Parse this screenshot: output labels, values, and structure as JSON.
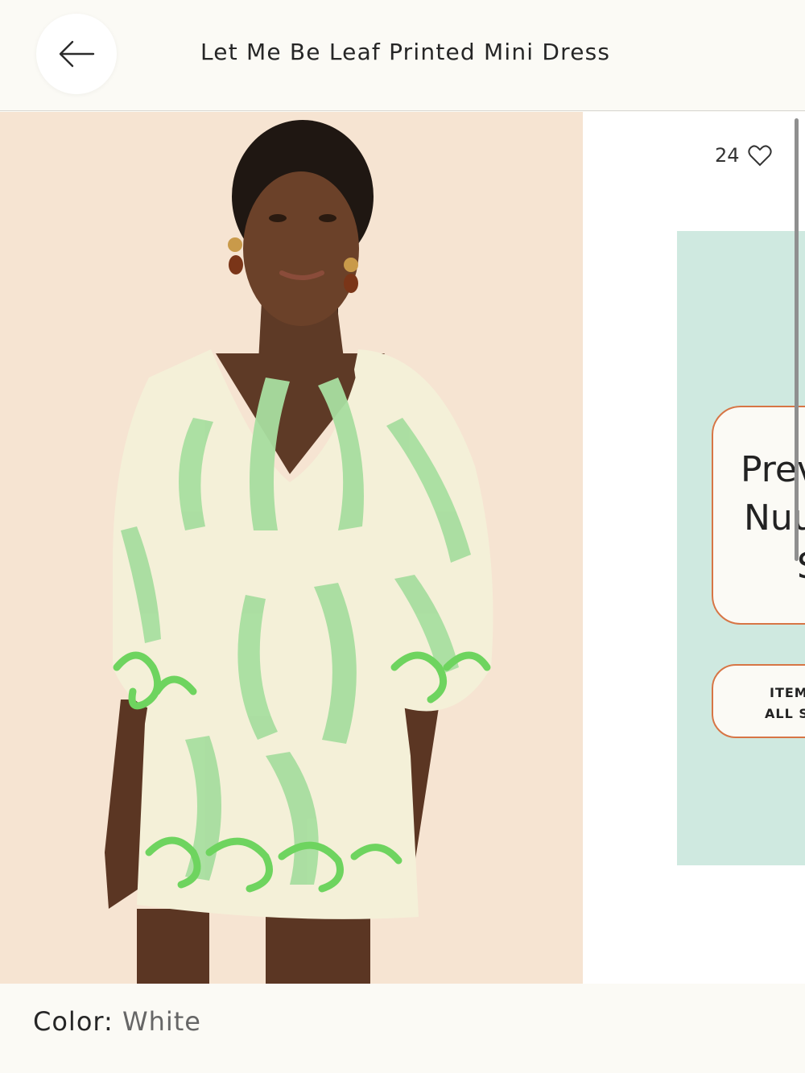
{
  "header": {
    "back_icon": "arrow-left-icon",
    "title": "Let Me Be Leaf Printed Mini Dress"
  },
  "gallery": {
    "likes_count": "24",
    "like_icon": "heart-outline-icon",
    "promo": {
      "headline_lines": [
        "Prev",
        "Nuu",
        "S"
      ],
      "pill_lines": [
        "ITEM",
        "ALL S"
      ],
      "background": "#cfe9e0",
      "accent": "#d77545"
    }
  },
  "product": {
    "color_label": "Color:",
    "color_value": "White"
  }
}
